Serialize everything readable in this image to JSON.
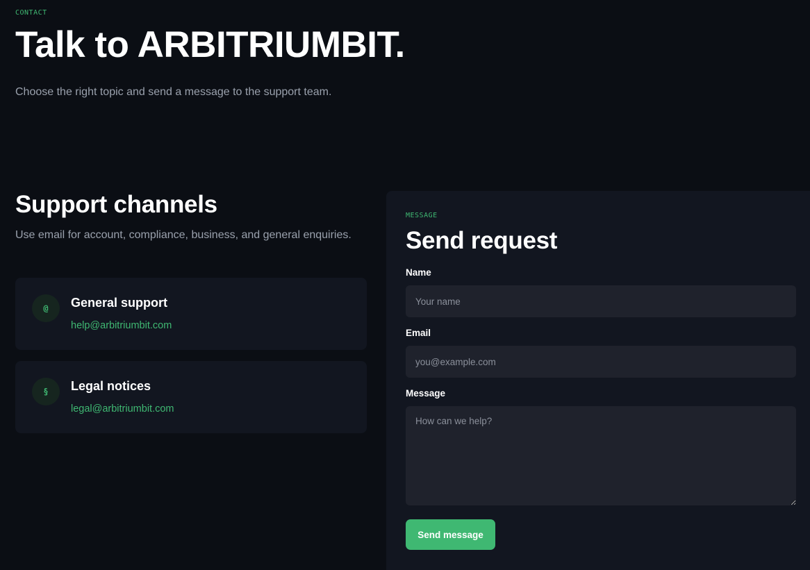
{
  "hero": {
    "eyebrow": "CONTACT",
    "title": "Talk to ARBITRIUMBIT.",
    "subtitle": "Choose the right topic and send a message to the support team."
  },
  "channels": {
    "title": "Support channels",
    "subtitle": "Use email for account, compliance, business, and general enquiries.",
    "items": [
      {
        "icon": "@",
        "icon_name": "at-sign-icon",
        "name": "General support",
        "email": "help@arbitriumbit.com"
      },
      {
        "icon": "§",
        "icon_name": "section-sign-icon",
        "name": "Legal notices",
        "email": "legal@arbitriumbit.com"
      }
    ]
  },
  "form": {
    "eyebrow": "MESSAGE",
    "title": "Send request",
    "name_label": "Name",
    "name_placeholder": "Your name",
    "email_label": "Email",
    "email_placeholder": "you@example.com",
    "message_label": "Message",
    "message_placeholder": "How can we help?",
    "submit_label": "Send message"
  },
  "colors": {
    "background": "#0b0e14",
    "card": "#121620",
    "input": "#1f222c",
    "accent": "#3fb872",
    "muted_text": "#9aa1ad"
  }
}
